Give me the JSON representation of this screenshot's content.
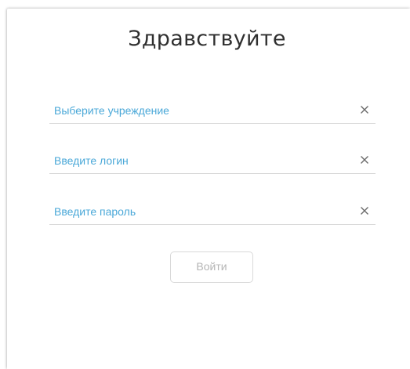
{
  "form": {
    "title": "Здравствуйте",
    "fields": [
      {
        "placeholder": "Выберите учреждение",
        "clear_icon": "close-icon"
      },
      {
        "placeholder": "Введите логин",
        "clear_icon": "close-icon"
      },
      {
        "placeholder": "Введите пароль",
        "clear_icon": "close-icon"
      }
    ],
    "submit_label": "Войти"
  },
  "colors": {
    "accent": "#4aa8d8",
    "title": "#2f2f2f",
    "button_text_disabled": "#b5b5b5",
    "divider": "#d8d8d8"
  }
}
